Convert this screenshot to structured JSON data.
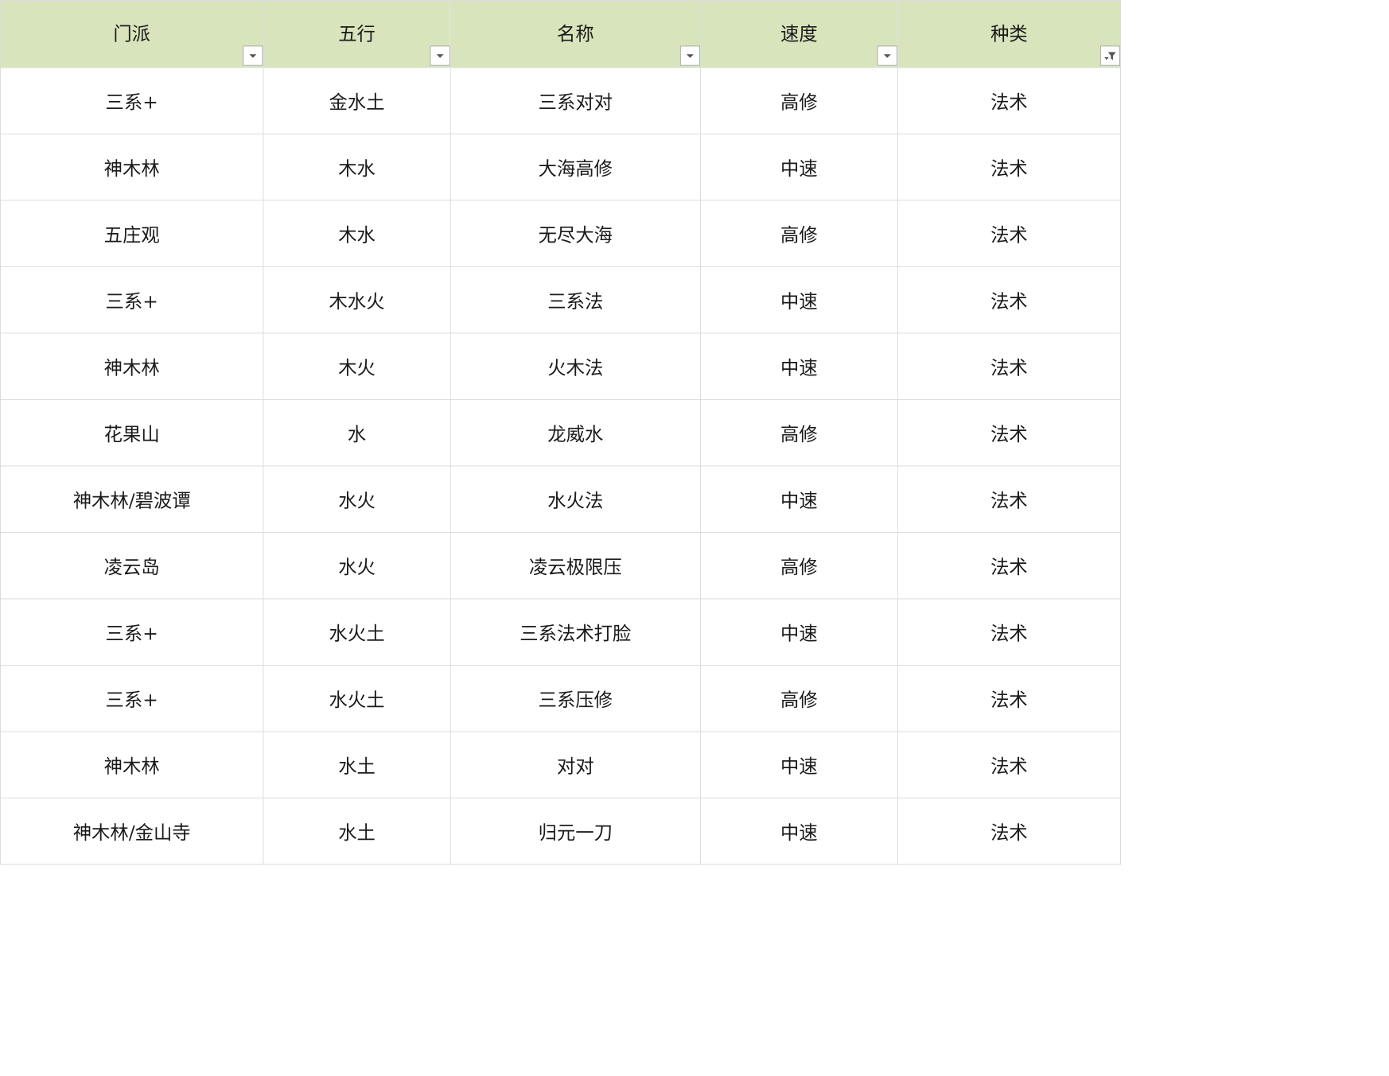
{
  "table": {
    "headers": [
      {
        "label": "门派",
        "filter": "dropdown"
      },
      {
        "label": "五行",
        "filter": "dropdown"
      },
      {
        "label": "名称",
        "filter": "dropdown"
      },
      {
        "label": "速度",
        "filter": "dropdown"
      },
      {
        "label": "种类",
        "filter": "filtered"
      }
    ],
    "rows": [
      [
        "三系+",
        "金水土",
        "三系对对",
        "高修",
        "法术"
      ],
      [
        "神木林",
        "木水",
        "大海高修",
        "中速",
        "法术"
      ],
      [
        "五庄观",
        "木水",
        "无尽大海",
        "高修",
        "法术"
      ],
      [
        "三系+",
        "木水火",
        "三系法",
        "中速",
        "法术"
      ],
      [
        "神木林",
        "木火",
        "火木法",
        "中速",
        "法术"
      ],
      [
        "花果山",
        "水",
        "龙威水",
        "高修",
        "法术"
      ],
      [
        "神木林/碧波谭",
        "水火",
        "水火法",
        "中速",
        "法术"
      ],
      [
        "凌云岛",
        "水火",
        "凌云极限压",
        "高修",
        "法术"
      ],
      [
        "三系+",
        "水火土",
        "三系法术打脸",
        "中速",
        "法术"
      ],
      [
        "三系+",
        "水火土",
        "三系压修",
        "高修",
        "法术"
      ],
      [
        "神木林",
        "水土",
        "对对",
        "中速",
        "法术"
      ],
      [
        "神木林/金山寺",
        "水土",
        "归元一刀",
        "中速",
        "法术"
      ]
    ]
  },
  "colors": {
    "header_bg": "#d8e4bc",
    "grid_line": "#d9d9d9",
    "text": "#1a1a1a"
  }
}
